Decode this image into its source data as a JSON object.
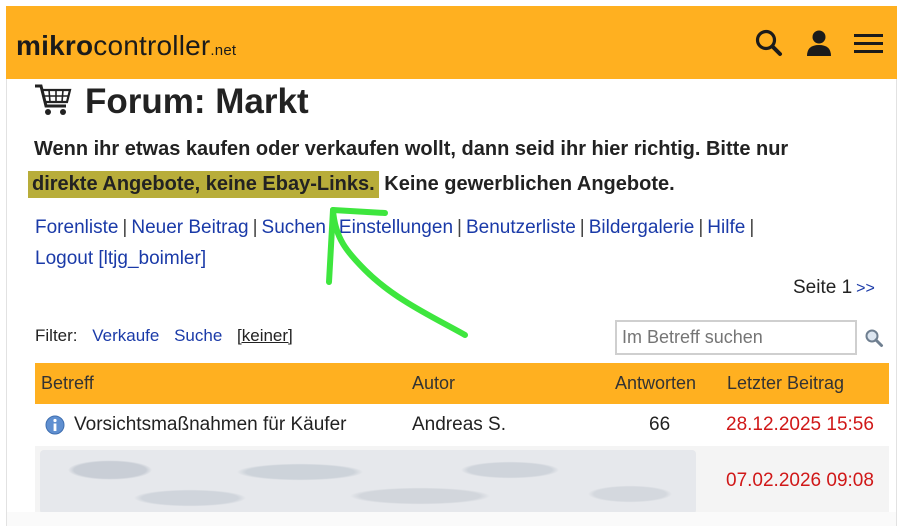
{
  "header": {
    "logo_bold": "mikro",
    "logo_regular": "controller",
    "logo_suffix": ".net",
    "icons": [
      "search-icon",
      "user-icon",
      "menu-icon"
    ],
    "bar_color": "#FFB020"
  },
  "page": {
    "title": "Forum: Markt",
    "notice_part1": "Wenn ihr etwas kaufen oder verkaufen wollt, dann seid ihr hier richtig. Bitte nur",
    "notice_highlight": "direkte Angebote, keine Ebay-Links.",
    "notice_part2": "Keine gewerblichen Angebote.",
    "highlight_color": "#B8AD3A"
  },
  "nav": {
    "links": [
      "Forenliste",
      "Neuer Beitrag",
      "Suchen",
      "Einstellungen",
      "Benutzerliste",
      "Bildergalerie",
      "Hilfe",
      "Logout [ltjg_boimler]"
    ],
    "separator": "|"
  },
  "pager": {
    "label": "Seite 1",
    "next": ">>"
  },
  "filter": {
    "label": "Filter:",
    "options": [
      "Verkaufe",
      "Suche"
    ],
    "current": "[keiner]"
  },
  "search": {
    "placeholder": "Im Betreff suchen"
  },
  "table": {
    "headers": [
      "Betreff",
      "Autor",
      "Antworten",
      "Letzter Beitrag"
    ],
    "rows": [
      {
        "subject": "Vorsichtsmaßnahmen für Käufer",
        "author": "Andreas S.",
        "replies": "66",
        "last": "28.12.2025 15:56"
      },
      {
        "subject": "",
        "author": "",
        "replies": "",
        "last": "07.02.2026 09:08"
      }
    ]
  },
  "annotation": {
    "arrow_color": "#3EE63E"
  }
}
